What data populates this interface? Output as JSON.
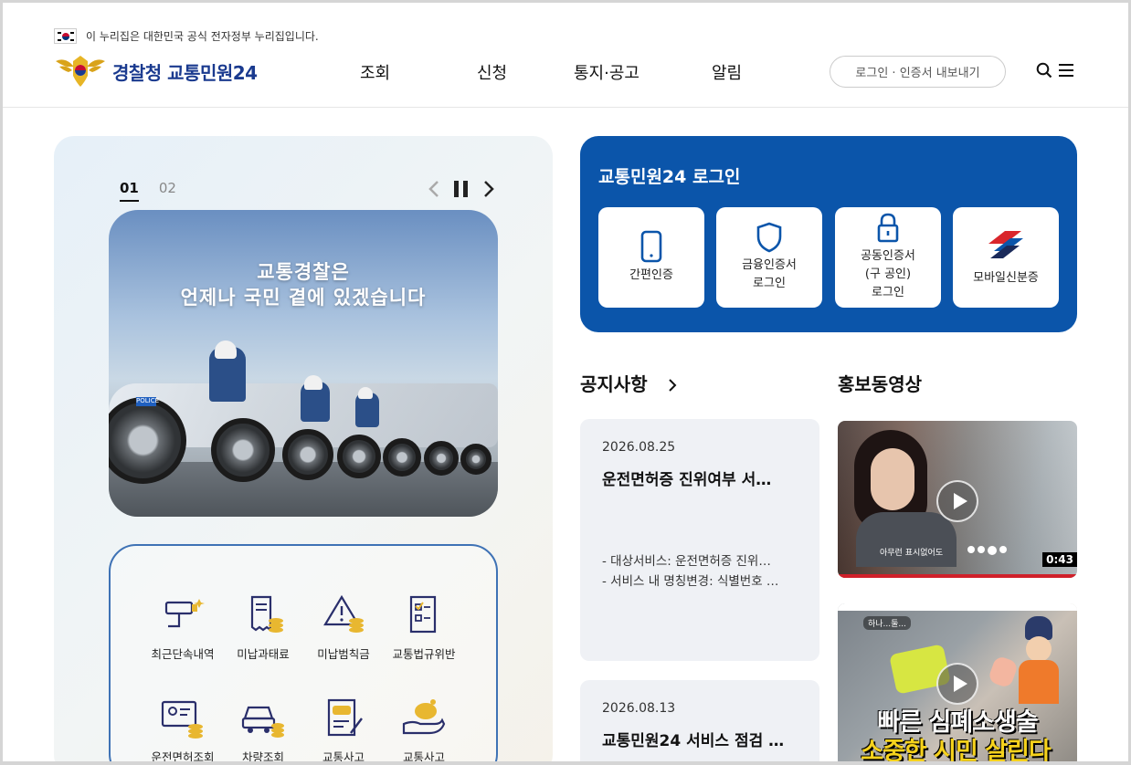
{
  "notice": {
    "text": "이 누리집은 대한민국 공식 전자정부 누리집입니다."
  },
  "header": {
    "logo_text": "경찰청 교통민원24",
    "nav": [
      "조회",
      "신청",
      "통지·공고",
      "알림"
    ],
    "login_button": "로그인 · 인증서 내보내기",
    "icons": [
      "search-icon",
      "menu-icon"
    ]
  },
  "banner": {
    "slide_numbers": [
      "01",
      "02"
    ],
    "active_slide": "01",
    "line1": "교통경찰은",
    "line2": "언제나 국민 곁에 있겠습니다"
  },
  "quick_menu": [
    {
      "label": "최근단속내역",
      "icon": "camera-icon"
    },
    {
      "label": "미납과태료",
      "icon": "receipt-coins-icon"
    },
    {
      "label": "미납범칙금",
      "icon": "warning-coins-icon"
    },
    {
      "label": "교통법규위반",
      "icon": "checklist-icon"
    },
    {
      "label": "운전면허조회",
      "icon": "license-coins-icon"
    },
    {
      "label": "차량조회",
      "icon": "car-coins-icon"
    },
    {
      "label": "교통사고",
      "icon": "document-pen-icon"
    },
    {
      "label": "교통사고",
      "icon": "piggybank-hand-icon"
    }
  ],
  "login": {
    "title": "교통민원24 로그인",
    "methods": [
      {
        "label": "간편인증",
        "icon": "phone-icon"
      },
      {
        "label": "금융인증서\n로그인",
        "line1": "금융인증서",
        "line2": "로그인",
        "icon": "shield-icon"
      },
      {
        "label": "공동인증서 (구 공인) 로그인",
        "line1": "공동인증서",
        "line2": "(구 공인)",
        "line3": "로그인",
        "icon": "lock-icon"
      },
      {
        "label": "모바일신분증",
        "icon": "mobile-id-icon"
      }
    ]
  },
  "notices": {
    "title": "공지사항",
    "items": [
      {
        "date": "2026.08.25",
        "title": "운전면허증 진위여부 서…",
        "lines": [
          "- 대상서비스: 운전면허증 진위…",
          "- 서비스 내 명칭변경: 식별번호 …"
        ]
      },
      {
        "date": "2026.08.13",
        "title": "교통민원24 서비스 점검 …"
      }
    ]
  },
  "videos": {
    "title": "홍보동영상",
    "items": [
      {
        "caption": "아무런 표시없어도",
        "duration": "0:43"
      },
      {
        "caption": "빠른 심폐소생술",
        "top_caption": "하나...둘...",
        "bottom_caption": "소중한 시민 살린다"
      }
    ]
  },
  "colors": {
    "brand_blue": "#0b55aa",
    "logo_navy": "#1a3a8f",
    "panel_border": "#3e72b5"
  }
}
